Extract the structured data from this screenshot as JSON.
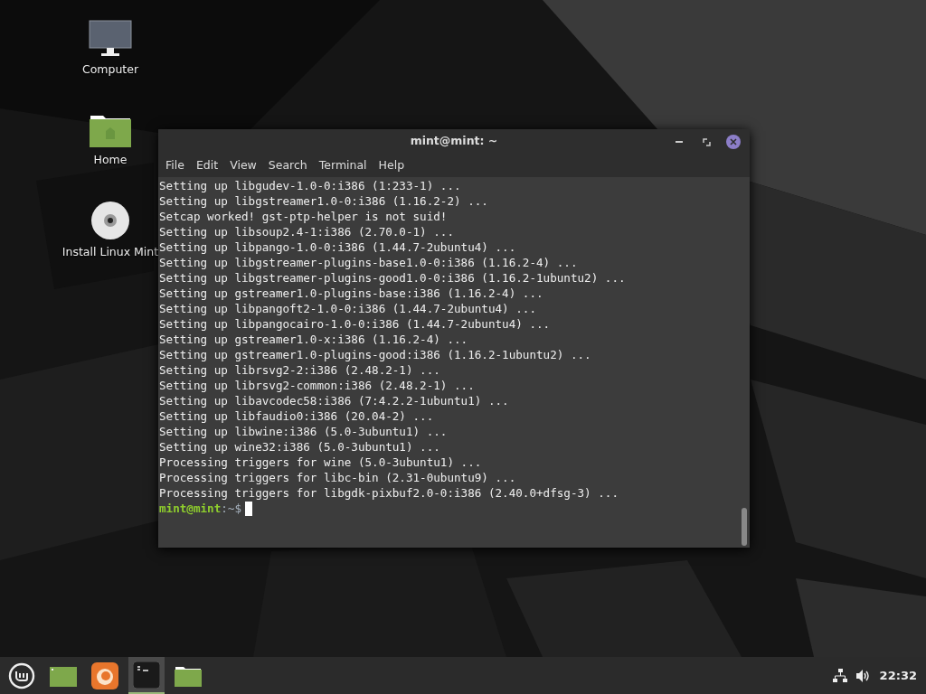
{
  "desktop_icons": [
    {
      "kind": "computer",
      "label": "Computer"
    },
    {
      "kind": "home",
      "label": "Home"
    },
    {
      "kind": "disc",
      "label": "Install Linux Mint"
    }
  ],
  "terminal": {
    "title": "mint@mint: ~",
    "menu": [
      "File",
      "Edit",
      "View",
      "Search",
      "Terminal",
      "Help"
    ],
    "lines": [
      "Setting up libgudev-1.0-0:i386 (1:233-1) ...",
      "Setting up libgstreamer1.0-0:i386 (1.16.2-2) ...",
      "Setcap worked! gst-ptp-helper is not suid!",
      "Setting up libsoup2.4-1:i386 (2.70.0-1) ...",
      "Setting up libpango-1.0-0:i386 (1.44.7-2ubuntu4) ...",
      "Setting up libgstreamer-plugins-base1.0-0:i386 (1.16.2-4) ...",
      "Setting up libgstreamer-plugins-good1.0-0:i386 (1.16.2-1ubuntu2) ...",
      "Setting up gstreamer1.0-plugins-base:i386 (1.16.2-4) ...",
      "Setting up libpangoft2-1.0-0:i386 (1.44.7-2ubuntu4) ...",
      "Setting up libpangocairo-1.0-0:i386 (1.44.7-2ubuntu4) ...",
      "Setting up gstreamer1.0-x:i386 (1.16.2-4) ...",
      "Setting up gstreamer1.0-plugins-good:i386 (1.16.2-1ubuntu2) ...",
      "Setting up librsvg2-2:i386 (2.48.2-1) ...",
      "Setting up librsvg2-common:i386 (2.48.2-1) ...",
      "Setting up libavcodec58:i386 (7:4.2.2-1ubuntu1) ...",
      "Setting up libfaudio0:i386 (20.04-2) ...",
      "Setting up libwine:i386 (5.0-3ubuntu1) ...",
      "Setting up wine32:i386 (5.0-3ubuntu1) ...",
      "Processing triggers for wine (5.0-3ubuntu1) ...",
      "Processing triggers for libc-bin (2.31-0ubuntu9) ...",
      "Processing triggers for libgdk-pixbuf2.0-0:i386 (2.40.0+dfsg-3) ..."
    ],
    "prompt": {
      "user_host": "mint@mint",
      "path": ":~$"
    }
  },
  "taskbar": {
    "items": [
      {
        "kind": "menu",
        "selected": false
      },
      {
        "kind": "desktop",
        "selected": false
      },
      {
        "kind": "browser",
        "selected": false
      },
      {
        "kind": "terminal",
        "selected": true
      },
      {
        "kind": "files",
        "selected": false
      }
    ],
    "clock": "22:32"
  }
}
